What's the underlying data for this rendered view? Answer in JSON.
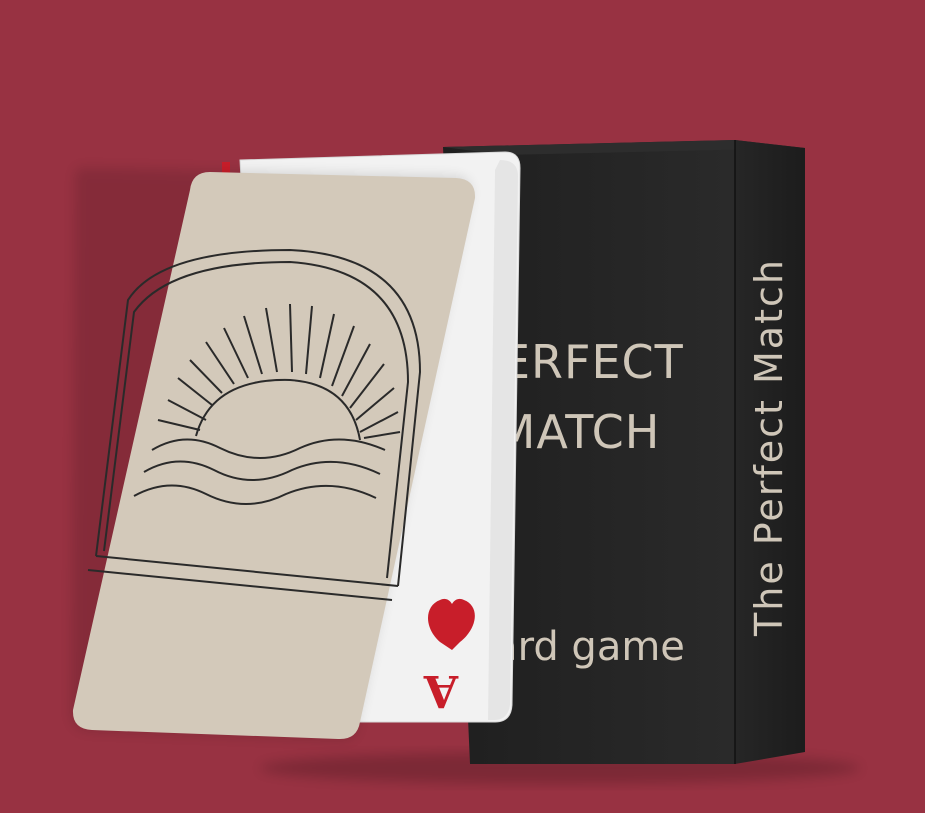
{
  "scene": {
    "background_color": "#983242",
    "box": {
      "front_title_line1": "PERFECT",
      "front_title_line2": "MATCH",
      "front_subtitle": "card game",
      "spine_text": "The Perfect Match",
      "color": "#252525",
      "text_color": "#cfc6b8"
    },
    "ace_card": {
      "rank": "A",
      "suit_icon": "heart-icon",
      "suit_color": "#c81e2a"
    },
    "front_card": {
      "color": "#d3c9ba",
      "illustration": "sunset-over-waves-icon"
    }
  }
}
